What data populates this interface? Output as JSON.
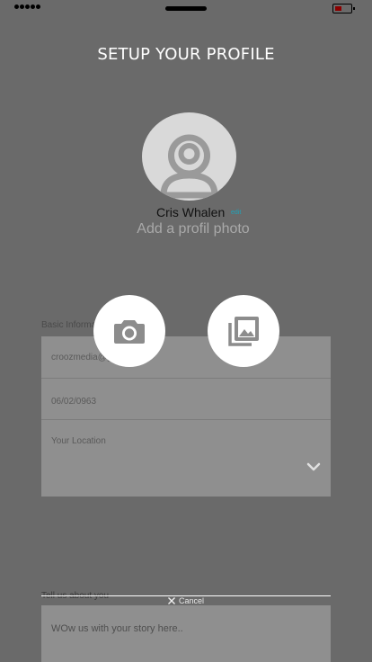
{
  "status_bar": {
    "battery_color": "#8b0000"
  },
  "header": {
    "title": "SETUP YOUR PROFILE"
  },
  "profile": {
    "name": "Cris Whalen",
    "edit_label": "edit",
    "add_photo_label": "Add a profil photo",
    "avatar_icon": "user-silhouette-icon"
  },
  "form": {
    "section_label": "Basic Information",
    "email_value": "croozmedia@gmail.com",
    "dob_value": "06/02/0963",
    "location_placeholder": "Your Location",
    "location_icon": "chevron-down-icon"
  },
  "photo_actions": {
    "camera_icon": "camera-icon",
    "gallery_icon": "photo-library-icon"
  },
  "about": {
    "label": "Tell us about you",
    "cancel_label": "Cancel",
    "placeholder": "WOw us with your story here.."
  },
  "colors": {
    "overlay": "#6a6a6a",
    "field_bg": "#8f8f8f",
    "accent": "#20a2b8",
    "title": "#ffffff"
  }
}
